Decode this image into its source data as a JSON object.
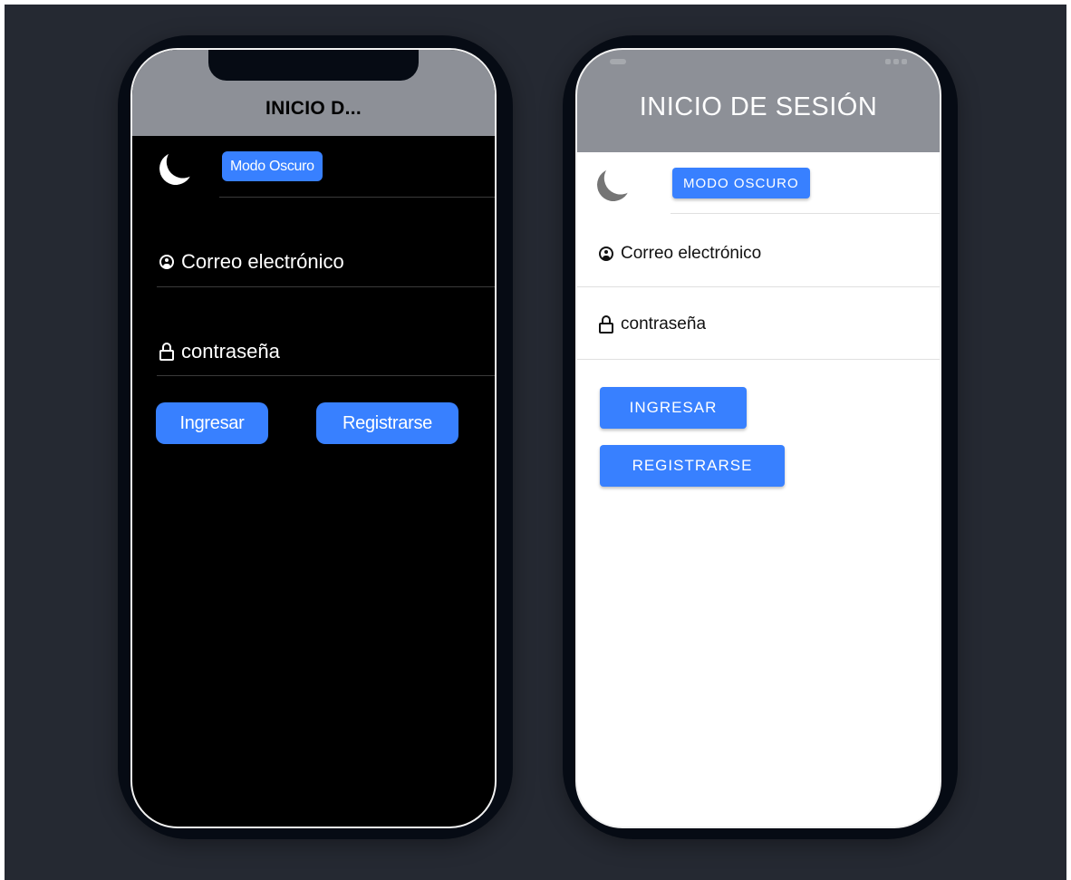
{
  "dark_preview": {
    "title": "INICIO D...",
    "dark_mode_chip": "Modo Oscuro",
    "email_label": "Correo electrónico",
    "password_label": "contraseña",
    "login_button": "Ingresar",
    "register_button": "Registrarse",
    "icons": [
      "moon-icon",
      "user-circle-icon",
      "lock-icon"
    ]
  },
  "light_preview": {
    "title": "INICIO DE SESIÓN",
    "dark_mode_chip": "MODO OSCURO",
    "email_label": "Correo electrónico",
    "password_label": "contraseña",
    "login_button": "INGRESAR",
    "register_button": "REGISTRARSE",
    "icons": [
      "moon-icon",
      "user-circle-icon",
      "lock-icon"
    ]
  },
  "colors": {
    "background": "#252932",
    "phone_frame": "#060b14",
    "header": "#8d9097",
    "accent": "#3880ff",
    "dark_screen": "#000000",
    "light_screen": "#ffffff"
  }
}
